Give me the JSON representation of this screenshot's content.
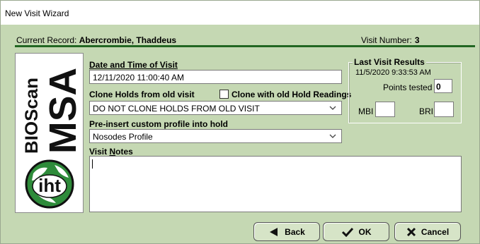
{
  "window": {
    "title": "New Visit Wizard"
  },
  "record": {
    "label": "Current Record:",
    "name": "Abercrombie, Thaddeus",
    "visit_label": "Visit Number:",
    "visit_number": "3"
  },
  "logo": {
    "line1": "BIOScan",
    "line2": "MSA",
    "globe_text": "iht"
  },
  "form": {
    "date_label": "Date and Time of Visit",
    "date_value": "12/11/2020 11:00:40 AM",
    "clone_label": "Clone Holds from old visit",
    "clone_checkbox_label": "Clone with old Hold Readings",
    "clone_checkbox_checked": false,
    "clone_value": "DO NOT CLONE HOLDS FROM OLD VISIT",
    "preinsert_label": "Pre-insert custom profile into hold",
    "preinsert_value": "Nosodes Profile",
    "notes_label": "Visit Notes",
    "notes_value": ""
  },
  "last_visit": {
    "title": "Last Visit Results",
    "date": "11/5/2020 9:33:53 AM",
    "points_label": "Points tested",
    "points_value": "0",
    "mbi_label": "MBI",
    "mbi_value": "",
    "bri_label": "BRI",
    "bri_value": ""
  },
  "buttons": {
    "back": "Back",
    "ok": "OK",
    "cancel": "Cancel"
  },
  "colors": {
    "window_bg": "#c5d8b3",
    "rule": "#226622",
    "button_bg": "#d6e4c7",
    "logo_green": "#2e8b3a"
  }
}
